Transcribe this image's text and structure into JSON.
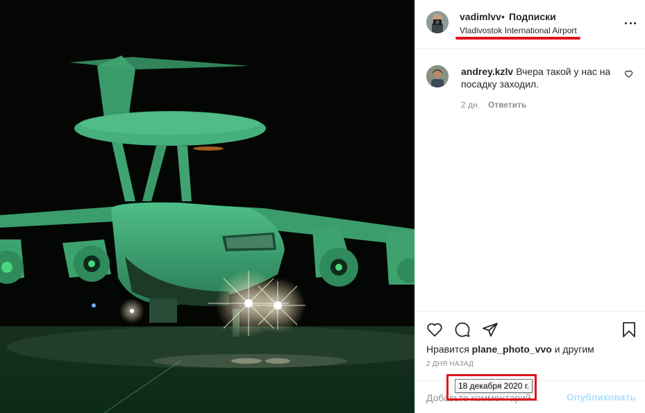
{
  "post": {
    "author": {
      "username": "vadimlvv",
      "follow_label": "Подписки",
      "separator": "•",
      "location": "Vladivostok International Airport",
      "avatar_icon": "camera-avatar"
    },
    "photo": {
      "icon": "aircraft-photo"
    },
    "comments": [
      {
        "username": "andrey.kzlv",
        "text": "Вчера такой у нас на посадку заходил.",
        "time": "2 дн.",
        "reply_label": "Ответить"
      }
    ],
    "actions": {
      "like_icon": "heart-icon",
      "comment_icon": "comment-icon",
      "share_icon": "share-icon",
      "save_icon": "bookmark-icon"
    },
    "likes": {
      "prefix": "Нравится",
      "user": "plane_photo_vvo",
      "suffix": "и другим"
    },
    "time_ago": "2 дня назад",
    "tooltip_date": "18 декабря 2020 г.",
    "add_comment_placeholder": "Добавьте комментарий...",
    "publish_label": "Опубликовать"
  },
  "colors": {
    "highlight_red": "#e0141e",
    "publish_disabled": "#b2dffc",
    "secondary_text": "#8e8e8e",
    "photo_green": "#3fae7a"
  }
}
